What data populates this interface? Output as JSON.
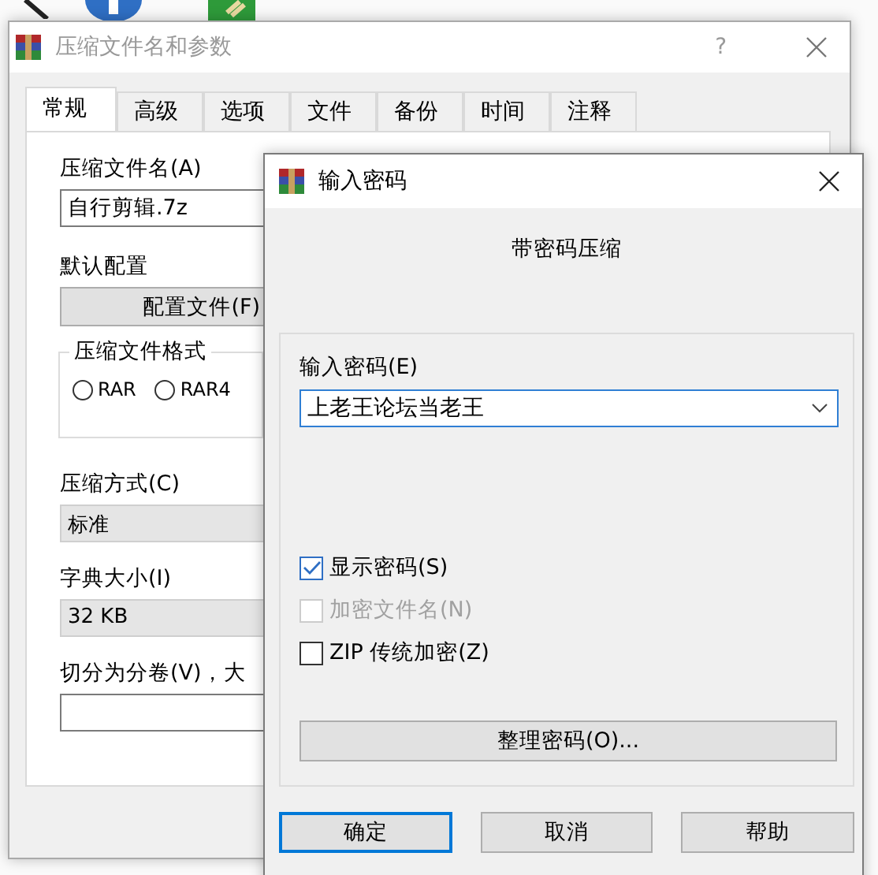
{
  "archive_dialog": {
    "title": "压缩文件名和参数",
    "help_button": "?",
    "tabs": [
      {
        "label": "常规",
        "selected": true
      },
      {
        "label": "高级",
        "selected": false
      },
      {
        "label": "选项",
        "selected": false
      },
      {
        "label": "文件",
        "selected": false
      },
      {
        "label": "备份",
        "selected": false
      },
      {
        "label": "时间",
        "selected": false
      },
      {
        "label": "注释",
        "selected": false
      }
    ],
    "archive_name_label": "压缩文件名(A)",
    "archive_name": "自行剪辑.7z",
    "profile_label": "默认配置",
    "profile_button": "配置文件(F)",
    "format_group": {
      "title": "压缩文件格式",
      "options": [
        {
          "label": "RAR",
          "selected": false
        },
        {
          "label": "RAR4",
          "selected": false
        }
      ]
    },
    "method_label": "压缩方式(C)",
    "method": "标准",
    "dictionary_label": "字典大小(I)",
    "dictionary": "32 KB",
    "split_label": "切分为分卷(V)，大"
  },
  "password_dialog": {
    "title": "输入密码",
    "heading": "带密码压缩",
    "password_label": "输入密码(E)",
    "password": "上老王论坛当老王",
    "options": [
      {
        "label": "显示密码(S)",
        "checked": true,
        "disabled": false
      },
      {
        "label": "加密文件名(N)",
        "checked": false,
        "disabled": true
      },
      {
        "label": "ZIP 传统加密(Z)",
        "checked": false,
        "disabled": false
      }
    ],
    "organize_button": "整理密码(O)...",
    "buttons": [
      {
        "label": "确定",
        "default": true
      },
      {
        "label": "取消",
        "default": false
      },
      {
        "label": "帮助",
        "default": false
      }
    ]
  }
}
